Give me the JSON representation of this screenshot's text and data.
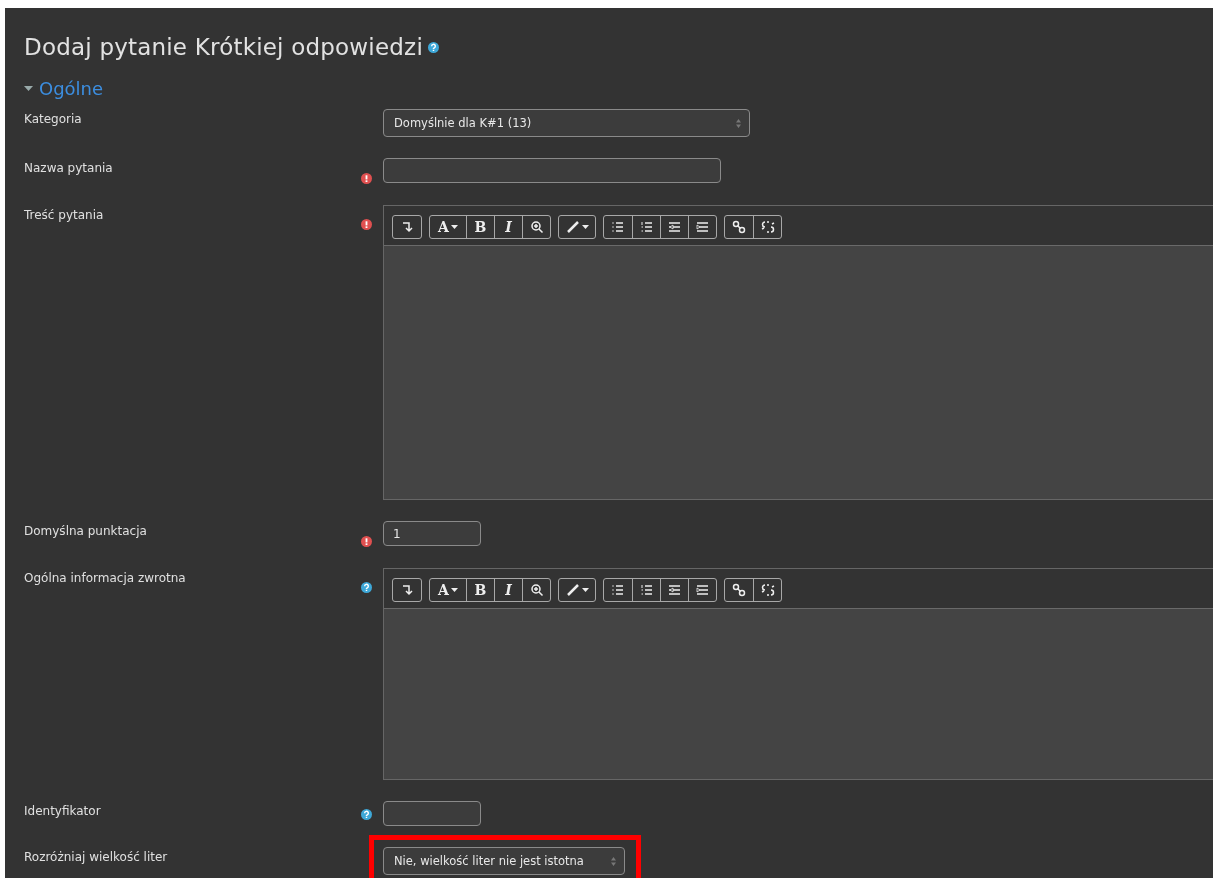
{
  "title": "Dodaj pytanie Krótkiej odpowiedzi",
  "section": {
    "label": "Ogólne",
    "expanded": true
  },
  "fields": [
    {
      "kind": "select",
      "label": "Kategoria",
      "required": false,
      "help": false,
      "value": "Domyślnie dla K#1 (13)",
      "highlighted": false
    },
    {
      "kind": "text",
      "label": "Nazwa pytania",
      "required": true,
      "help": false
    },
    {
      "kind": "editor",
      "label": "Treść pytania",
      "required": true,
      "help": false,
      "toolbar": [
        [
          {
            "kind": "collapse"
          }
        ],
        [
          {
            "kind": "text-menu",
            "label": "A"
          },
          {
            "kind": "text",
            "label": "B"
          },
          {
            "kind": "text-italic",
            "label": "I"
          },
          {
            "kind": "zoom"
          }
        ],
        [
          {
            "kind": "brush"
          }
        ],
        [
          {
            "kind": "bullets"
          },
          {
            "kind": "numbers"
          },
          {
            "kind": "outdent"
          },
          {
            "kind": "indent"
          }
        ],
        [
          {
            "kind": "link"
          },
          {
            "kind": "unlink"
          }
        ]
      ]
    },
    {
      "kind": "text",
      "label": "Domyślna punktacja",
      "required": true,
      "help": false,
      "value": "1"
    },
    {
      "kind": "editor",
      "label": "Ogólna informacja zwrotna",
      "required": false,
      "help": true,
      "toolbar": [
        [
          {
            "kind": "collapse"
          }
        ],
        [
          {
            "kind": "text-menu",
            "label": "A"
          },
          {
            "kind": "text",
            "label": "B"
          },
          {
            "kind": "text-italic",
            "label": "I"
          },
          {
            "kind": "zoom"
          }
        ],
        [
          {
            "kind": "brush"
          }
        ],
        [
          {
            "kind": "bullets"
          },
          {
            "kind": "numbers"
          },
          {
            "kind": "outdent"
          },
          {
            "kind": "indent"
          }
        ],
        [
          {
            "kind": "link"
          },
          {
            "kind": "unlink"
          }
        ]
      ]
    },
    {
      "kind": "text",
      "label": "Identyfikator",
      "required": false,
      "help": true
    },
    {
      "kind": "select",
      "label": "Rozróżniaj wielkość liter",
      "required": false,
      "help": false,
      "value": "Nie, wielkość liter nie jest istotna",
      "highlighted": true
    }
  ]
}
